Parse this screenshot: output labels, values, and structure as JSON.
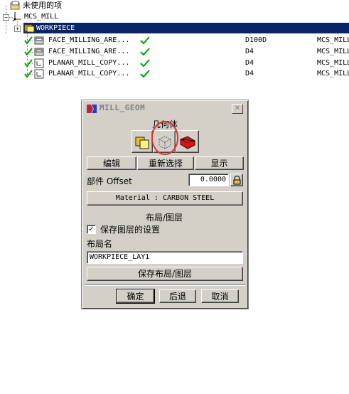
{
  "tree": {
    "unused_label": "未使用的项",
    "root_label": "MCS_MILL",
    "selected_label": "WORKPIECE",
    "operations": [
      {
        "name": "FACE_MILLING_ARE...",
        "tool": "D100D",
        "geometry": "MCS_MILL"
      },
      {
        "name": "FACE_MILLING_ARE...",
        "tool": "D4",
        "geometry": "MCS_MILL"
      },
      {
        "name": "PLANAR_MILL_COPY...",
        "tool": "D4",
        "geometry": "MCS_MILL"
      },
      {
        "name": "PLANAR_MILL_COPY...",
        "tool": "D4",
        "geometry": "MCS_MILL"
      }
    ]
  },
  "dialog": {
    "title": "MILL_GEOM",
    "geometry_header": "几何体",
    "edit_label": "编辑",
    "reselect_label": "重新选择",
    "display_label": "显示",
    "part_offset_label": "部件 Offset",
    "part_offset_value": "0.0000",
    "material_label": "Material : CARBON STEEL",
    "layout_header": "布局/图层",
    "save_layer_settings_label": "保存图层的设置",
    "save_layer_settings_checked": true,
    "layout_name_label": "布局名",
    "layout_name_value": "WORKPIECE_LAY1",
    "save_layout_label": "保存布局/图层",
    "ok_label": "确定",
    "back_label": "后退",
    "cancel_label": "取消"
  }
}
